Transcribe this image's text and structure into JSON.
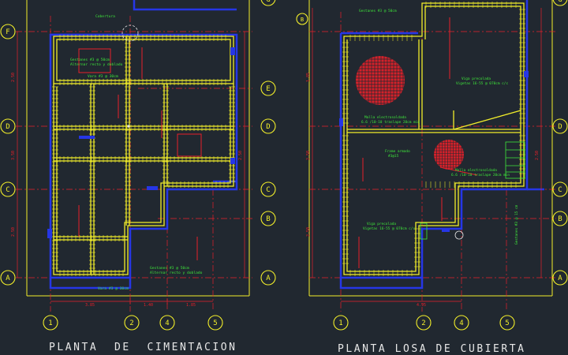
{
  "titles": {
    "left": "PLANTA  DE  CIMENTACION",
    "right": "PLANTA LOSA DE CUBIERTA"
  },
  "axes": {
    "columns_left": [
      "1",
      "2",
      "4",
      "5"
    ],
    "columns_right": [
      "1",
      "2",
      "4",
      "5"
    ],
    "rows_left": [
      "F",
      "D",
      "C",
      "A"
    ],
    "rows_mid": [
      "G",
      "E",
      "D",
      "C",
      "B",
      "A"
    ],
    "rows_right": [
      "G",
      "D",
      "C",
      "B",
      "A"
    ],
    "row_right_b_top": "B"
  },
  "labels": {
    "left_estribos_1": "Gestanes #3 @ 50cm",
    "left_estribos_1b": "Alternar recto y doblado",
    "left_varilla_1": "Vara #3 @ 30cm",
    "left_estribos_2": "Gestanes #3 @ 50cm",
    "left_estribos_2b": "Alternar recto y doblado",
    "left_varilla_2": "Vara #3 @ 30cm",
    "right_top_note": "Gestanes #3 @ 50cm",
    "right_viga_1": "Viga precolada",
    "right_viga_1b": "Vigetas 16-55 @ 070cm c/c",
    "right_malla_1": "Malla electrosoldada",
    "right_malla_1b": "6.6 /10-10 traslape 20cm min",
    "right_viga_2": "Viga precolada",
    "right_viga_2b": "Vigetas 16-55 @ 070cm c/c",
    "right_malla_2": "Malla electrosoldada",
    "right_malla_2b": "6.6 /10-10 traslape 20cm min",
    "right_armado": "Frame armado",
    "right_armado_b": "#3@15",
    "right_side_note": "Gestanes #3 @ 15 cm",
    "left_corner_label": "Cobertura"
  },
  "dims": {
    "left_bottom": [
      "3.85",
      "1.40",
      "1.85"
    ],
    "left_side": [
      "2.50",
      "3.50",
      "2.50",
      "2.50"
    ],
    "right_bottom": [
      "4.95"
    ],
    "right_side": [
      "1.85",
      "2.50",
      "2.50",
      "2.50"
    ]
  },
  "colors": {
    "background": "#212830",
    "yellow": "#f2ee2a",
    "red": "#e8202a",
    "blue": "#2636e6",
    "green": "#3ee63a",
    "white": "#e7e7e7",
    "grey": "#8a8a8a"
  }
}
